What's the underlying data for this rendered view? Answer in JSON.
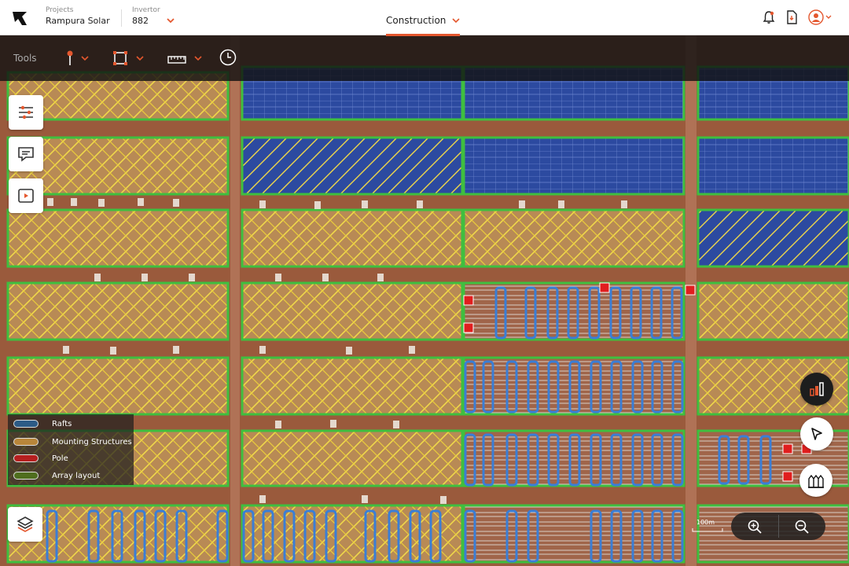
{
  "header": {
    "projects_label": "Projects",
    "projects_value": "Rampura Solar",
    "inverter_label": "Invertor",
    "inverter_value": "882",
    "active_tab": "Construction"
  },
  "toolbar": {
    "tools_label": "Tools"
  },
  "legend": {
    "items": [
      {
        "label": "Rafts",
        "color": "#2d5b86"
      },
      {
        "label": "Mounting Structures",
        "color": "#b8863a"
      },
      {
        "label": "Pole",
        "color": "#b51f1f"
      },
      {
        "label": "Array layout",
        "color": "#4f6e1e"
      }
    ]
  },
  "map": {
    "scale_label": "100m"
  },
  "colors": {
    "accent": "#e4572e",
    "array_outline": "#3fbf3f",
    "mounting": "#e8c84a",
    "raft": "#3a7ed6",
    "pole": "#e01e1e",
    "panel": "#2f4fa8",
    "soil": "#9a5a3c"
  },
  "icons": [
    "logo-icon",
    "bell-icon",
    "report-icon",
    "user-avatar-icon",
    "pin-icon",
    "select-box-icon",
    "ruler-icon",
    "clock-icon",
    "filter-icon",
    "comment-icon",
    "video-icon",
    "layers-icon",
    "chart-icon",
    "cursor-icon",
    "inventory-icon",
    "zoom-in-icon",
    "zoom-out-icon"
  ]
}
